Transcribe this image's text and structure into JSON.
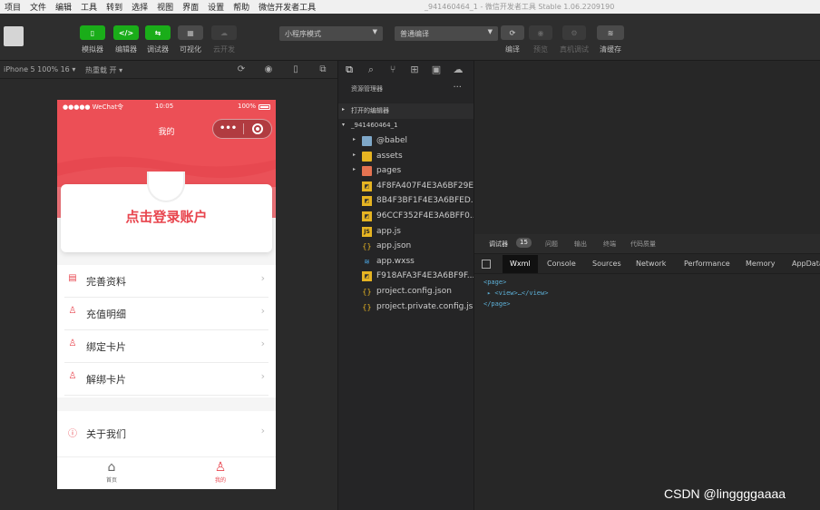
{
  "menubar": {
    "items": [
      "项目",
      "文件",
      "编辑",
      "工具",
      "转到",
      "选择",
      "视图",
      "界面",
      "设置",
      "帮助",
      "微信开发者工具"
    ],
    "title": "_941460464_1 - 微信开发者工具 Stable 1.06.2209190"
  },
  "toolbar": {
    "buttons": [
      {
        "label": "模拟器",
        "glyph": "▯"
      },
      {
        "label": "编辑器",
        "glyph": "</>"
      },
      {
        "label": "调试器",
        "glyph": "⇆"
      },
      {
        "label": "可视化",
        "glyph": "▦"
      },
      {
        "label": "云开发",
        "glyph": "☁"
      }
    ],
    "mode_select": "小程序模式",
    "compile_select": "普通编译",
    "right_buttons": [
      {
        "label": "编译",
        "glyph": "⟳"
      },
      {
        "label": "预览",
        "glyph": "◉"
      },
      {
        "label": "真机调试",
        "glyph": "⚙"
      },
      {
        "label": "清缓存",
        "glyph": "≋"
      }
    ]
  },
  "subbar": {
    "device": "iPhone 5 100% 16 ▾",
    "hotreload": "热重载 开 ▾"
  },
  "phone": {
    "carrier": "●●●●● WeChat令",
    "time": "10:05",
    "battery": "100%",
    "nav_title": "我的",
    "capsule_dots": "•••",
    "login_text": "点击登录账户",
    "menu": [
      {
        "icon": "calendar-icon",
        "glyph": "▤",
        "label": "完善资料"
      },
      {
        "icon": "user-icon",
        "glyph": "♙",
        "label": "充值明细"
      },
      {
        "icon": "user-icon",
        "glyph": "♙",
        "label": "绑定卡片"
      },
      {
        "icon": "user-icon",
        "glyph": "♙",
        "label": "解绑卡片"
      }
    ],
    "about": {
      "glyph": "ⓘ",
      "label": "关于我们"
    },
    "arrow": "›",
    "tabs": [
      {
        "label": "首页",
        "glyph": "⌂"
      },
      {
        "label": "我的",
        "glyph": "♙"
      }
    ]
  },
  "explorer": {
    "header": "资源管理器",
    "more": "···",
    "open_editors": "打开的编辑器",
    "project": "_941460464_1",
    "files": [
      {
        "name": "@babel",
        "type": "folder",
        "arrow": "▸"
      },
      {
        "name": "assets",
        "type": "folderY",
        "arrow": "▸"
      },
      {
        "name": "pages",
        "type": "folderR",
        "arrow": "▸"
      },
      {
        "name": "4F8FA407F4E3A6BF29E...",
        "type": "img"
      },
      {
        "name": "8B4F3BF1F4E3A6BFED...",
        "type": "img"
      },
      {
        "name": "96CCF352F4E3A6BFF0...",
        "type": "img"
      },
      {
        "name": "app.js",
        "type": "js"
      },
      {
        "name": "app.json",
        "type": "json"
      },
      {
        "name": "app.wxss",
        "type": "wxss"
      },
      {
        "name": "F918AFA3F4E3A6BF9F...",
        "type": "img"
      },
      {
        "name": "project.config.json",
        "type": "json"
      },
      {
        "name": "project.private.config.js...",
        "type": "json"
      }
    ]
  },
  "devtools": {
    "top_tabs": [
      "调试器",
      "问题",
      "输出",
      "终端",
      "代码质量"
    ],
    "badge": "15",
    "tabs": [
      "Wxml",
      "Console",
      "Sources",
      "Network",
      "Performance",
      "Memory",
      "AppData"
    ],
    "code": [
      "<page>",
      "▸ <view>…</view>",
      "</page>"
    ]
  },
  "watermark": "CSDN @linggggaaaa",
  "colors": {
    "accent_red": "#e8454e",
    "toolbar_green": "#1aad19"
  }
}
